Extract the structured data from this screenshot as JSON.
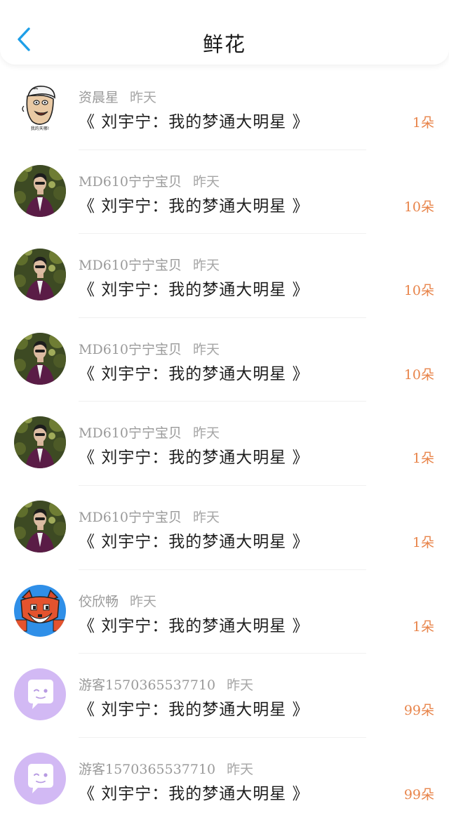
{
  "header": {
    "title": "鲜花"
  },
  "colors": {
    "accent": "#1e9fe8",
    "amount": "#e8844a",
    "guest_avatar_bg": "#d2b9f4"
  },
  "records": [
    {
      "name": "资晨星",
      "time": "昨天",
      "book": "《 刘宇宁：我的梦通大明星 》",
      "amount": "1朵",
      "avatar": "cartoon-man-avatar"
    },
    {
      "name": "MD610宁宁宝贝",
      "time": "昨天",
      "book": "《 刘宇宁：我的梦通大明星 》",
      "amount": "10朵",
      "avatar": "photo-man-suit-avatar"
    },
    {
      "name": "MD610宁宁宝贝",
      "time": "昨天",
      "book": "《 刘宇宁：我的梦通大明星 》",
      "amount": "10朵",
      "avatar": "photo-man-suit-avatar"
    },
    {
      "name": "MD610宁宁宝贝",
      "time": "昨天",
      "book": "《 刘宇宁：我的梦通大明星 》",
      "amount": "10朵",
      "avatar": "photo-man-suit-avatar"
    },
    {
      "name": "MD610宁宁宝贝",
      "time": "昨天",
      "book": "《 刘宇宁：我的梦通大明星 》",
      "amount": "1朵",
      "avatar": "photo-man-suit-avatar"
    },
    {
      "name": "MD610宁宁宝贝",
      "time": "昨天",
      "book": "《 刘宇宁：我的梦通大明星 》",
      "amount": "1朵",
      "avatar": "photo-man-suit-avatar"
    },
    {
      "name": "佼欣畅",
      "time": "昨天",
      "book": "《 刘宇宁：我的梦通大明星 》",
      "amount": "1朵",
      "avatar": "pixel-fox-avatar"
    },
    {
      "name": "游客1570365537710",
      "time": "昨天",
      "book": "《 刘宇宁：我的梦通大明星 》",
      "amount": "99朵",
      "avatar": "guest-chat-bubble-avatar"
    },
    {
      "name": "游客1570365537710",
      "time": "昨天",
      "book": "《 刘宇宁：我的梦通大明星 》",
      "amount": "99朵",
      "avatar": "guest-chat-bubble-avatar"
    }
  ]
}
